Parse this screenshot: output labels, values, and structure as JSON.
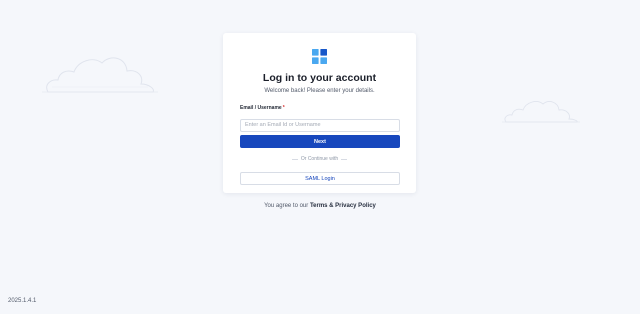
{
  "login": {
    "title": "Log in to your account",
    "subtitle": "Welcome back! Please enter your details.",
    "email_label": "Email / Username",
    "required_marker": "*",
    "email_placeholder": "Enter an Email Id or Username",
    "email_value": "",
    "next_label": "Next",
    "divider_text": "Or Continue with",
    "saml_label": "SAML Login"
  },
  "footer": {
    "agreement_prefix": "You agree to our",
    "agreement_link": "Terms & Privacy Policy",
    "version": "2025.1.4.1"
  },
  "colors": {
    "primary": "#1747bd",
    "background": "#f5f7fb",
    "logo_dark": "#1757c9",
    "logo_light": "#4aa8f0"
  },
  "icons": {
    "logo": "grid-logo-icon"
  }
}
